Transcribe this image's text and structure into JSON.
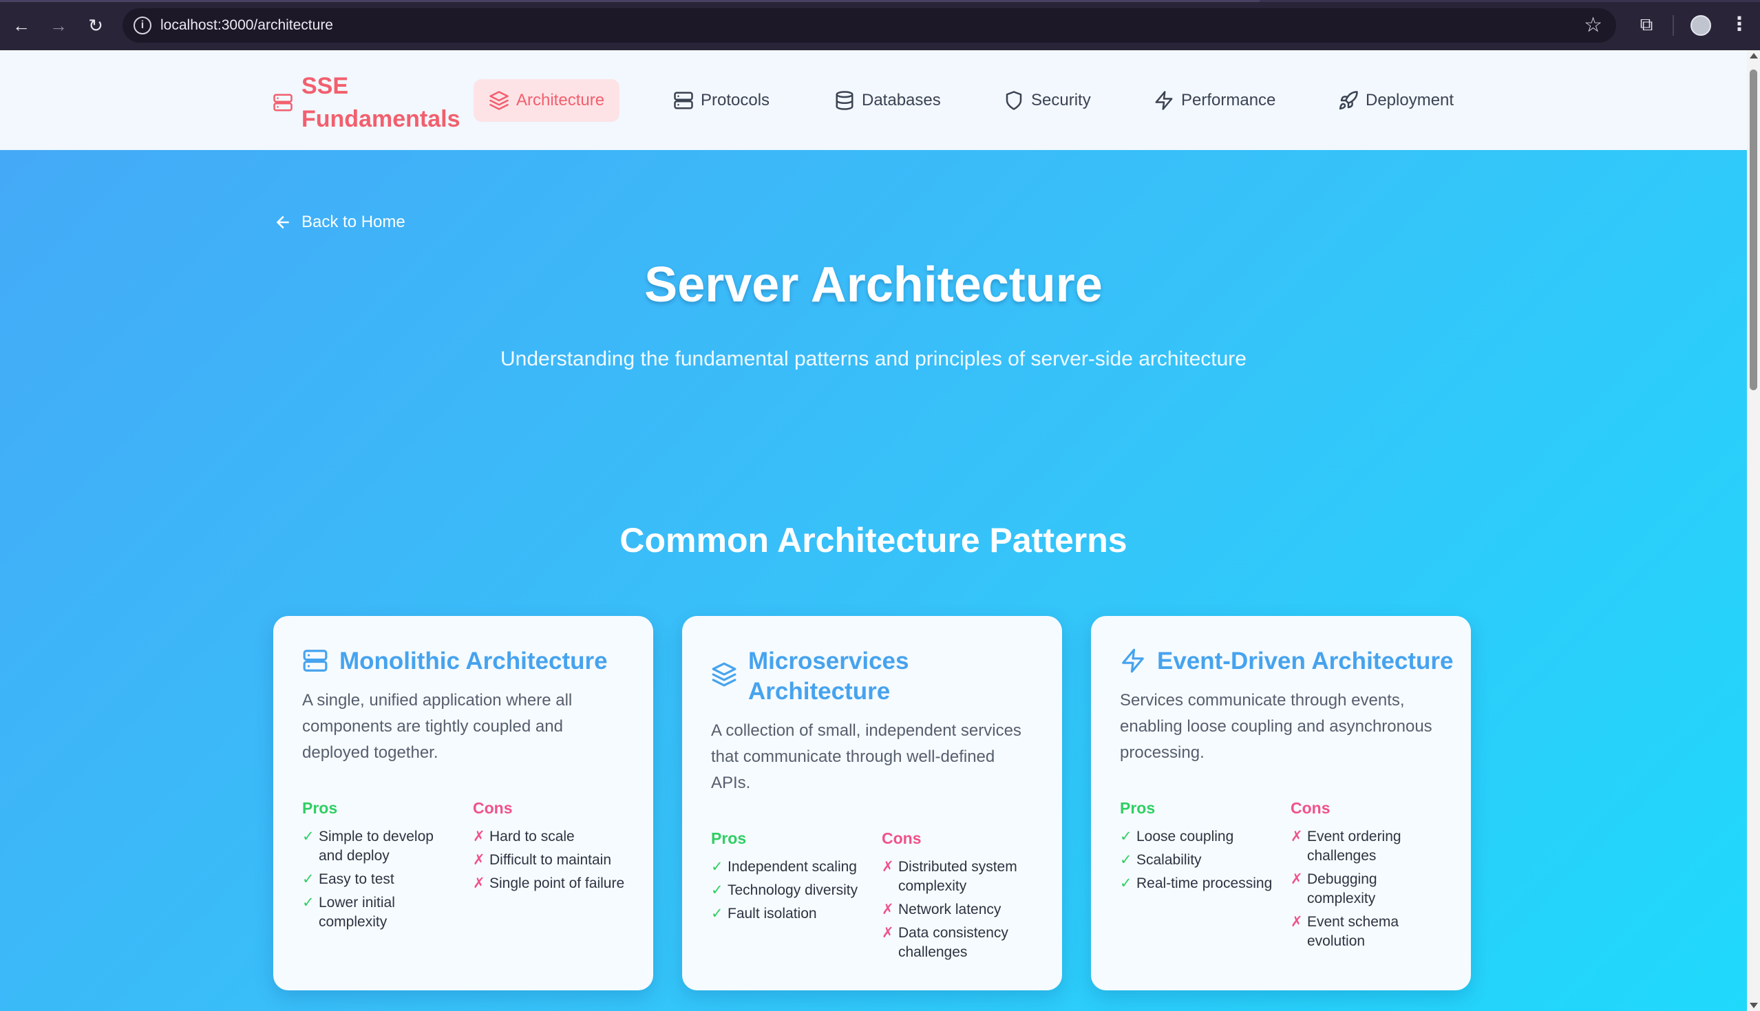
{
  "browser": {
    "url": "localhost:3000/architecture"
  },
  "nav": {
    "brand": "SSE Fundamentals",
    "items": [
      {
        "label": "Architecture",
        "icon": "layers-icon",
        "active": true
      },
      {
        "label": "Protocols",
        "icon": "server-icon",
        "active": false
      },
      {
        "label": "Databases",
        "icon": "database-icon",
        "active": false
      },
      {
        "label": "Security",
        "icon": "shield-icon",
        "active": false
      },
      {
        "label": "Performance",
        "icon": "zap-icon",
        "active": false
      },
      {
        "label": "Deployment",
        "icon": "rocket-icon",
        "active": false
      }
    ]
  },
  "page": {
    "back_label": "Back to Home",
    "title": "Server Architecture",
    "subtitle": "Understanding the fundamental patterns and principles of server-side architecture",
    "section_title": "Common Architecture Patterns"
  },
  "labels": {
    "pros": "Pros",
    "cons": "Cons",
    "pro_mark": "✓",
    "con_mark": "✗"
  },
  "cards": [
    {
      "icon": "server-icon",
      "title": "Monolithic Architecture",
      "description": "A single, unified application where all components are tightly coupled and deployed together.",
      "pros": [
        "Simple to develop and deploy",
        "Easy to test",
        "Lower initial complexity"
      ],
      "cons": [
        "Hard to scale",
        "Difficult to maintain",
        "Single point of failure"
      ]
    },
    {
      "icon": "layers-icon",
      "title": "Microservices Architecture",
      "description": "A collection of small, independent services that communicate through well-defined APIs.",
      "pros": [
        "Independent scaling",
        "Technology diversity",
        "Fault isolation"
      ],
      "cons": [
        "Distributed system complexity",
        "Network latency",
        "Data consistency challenges"
      ]
    },
    {
      "icon": "zap-icon",
      "title": "Event-Driven Architecture",
      "description": "Services communicate through events, enabling loose coupling and asynchronous processing.",
      "pros": [
        "Loose coupling",
        "Scalability",
        "Real-time processing"
      ],
      "cons": [
        "Event ordering challenges",
        "Debugging complexity",
        "Event schema evolution"
      ]
    }
  ],
  "colors": {
    "brand": "#f25f6e",
    "accent": "#46a3ee",
    "pros": "#2fcf63",
    "cons": "#f0528a"
  }
}
